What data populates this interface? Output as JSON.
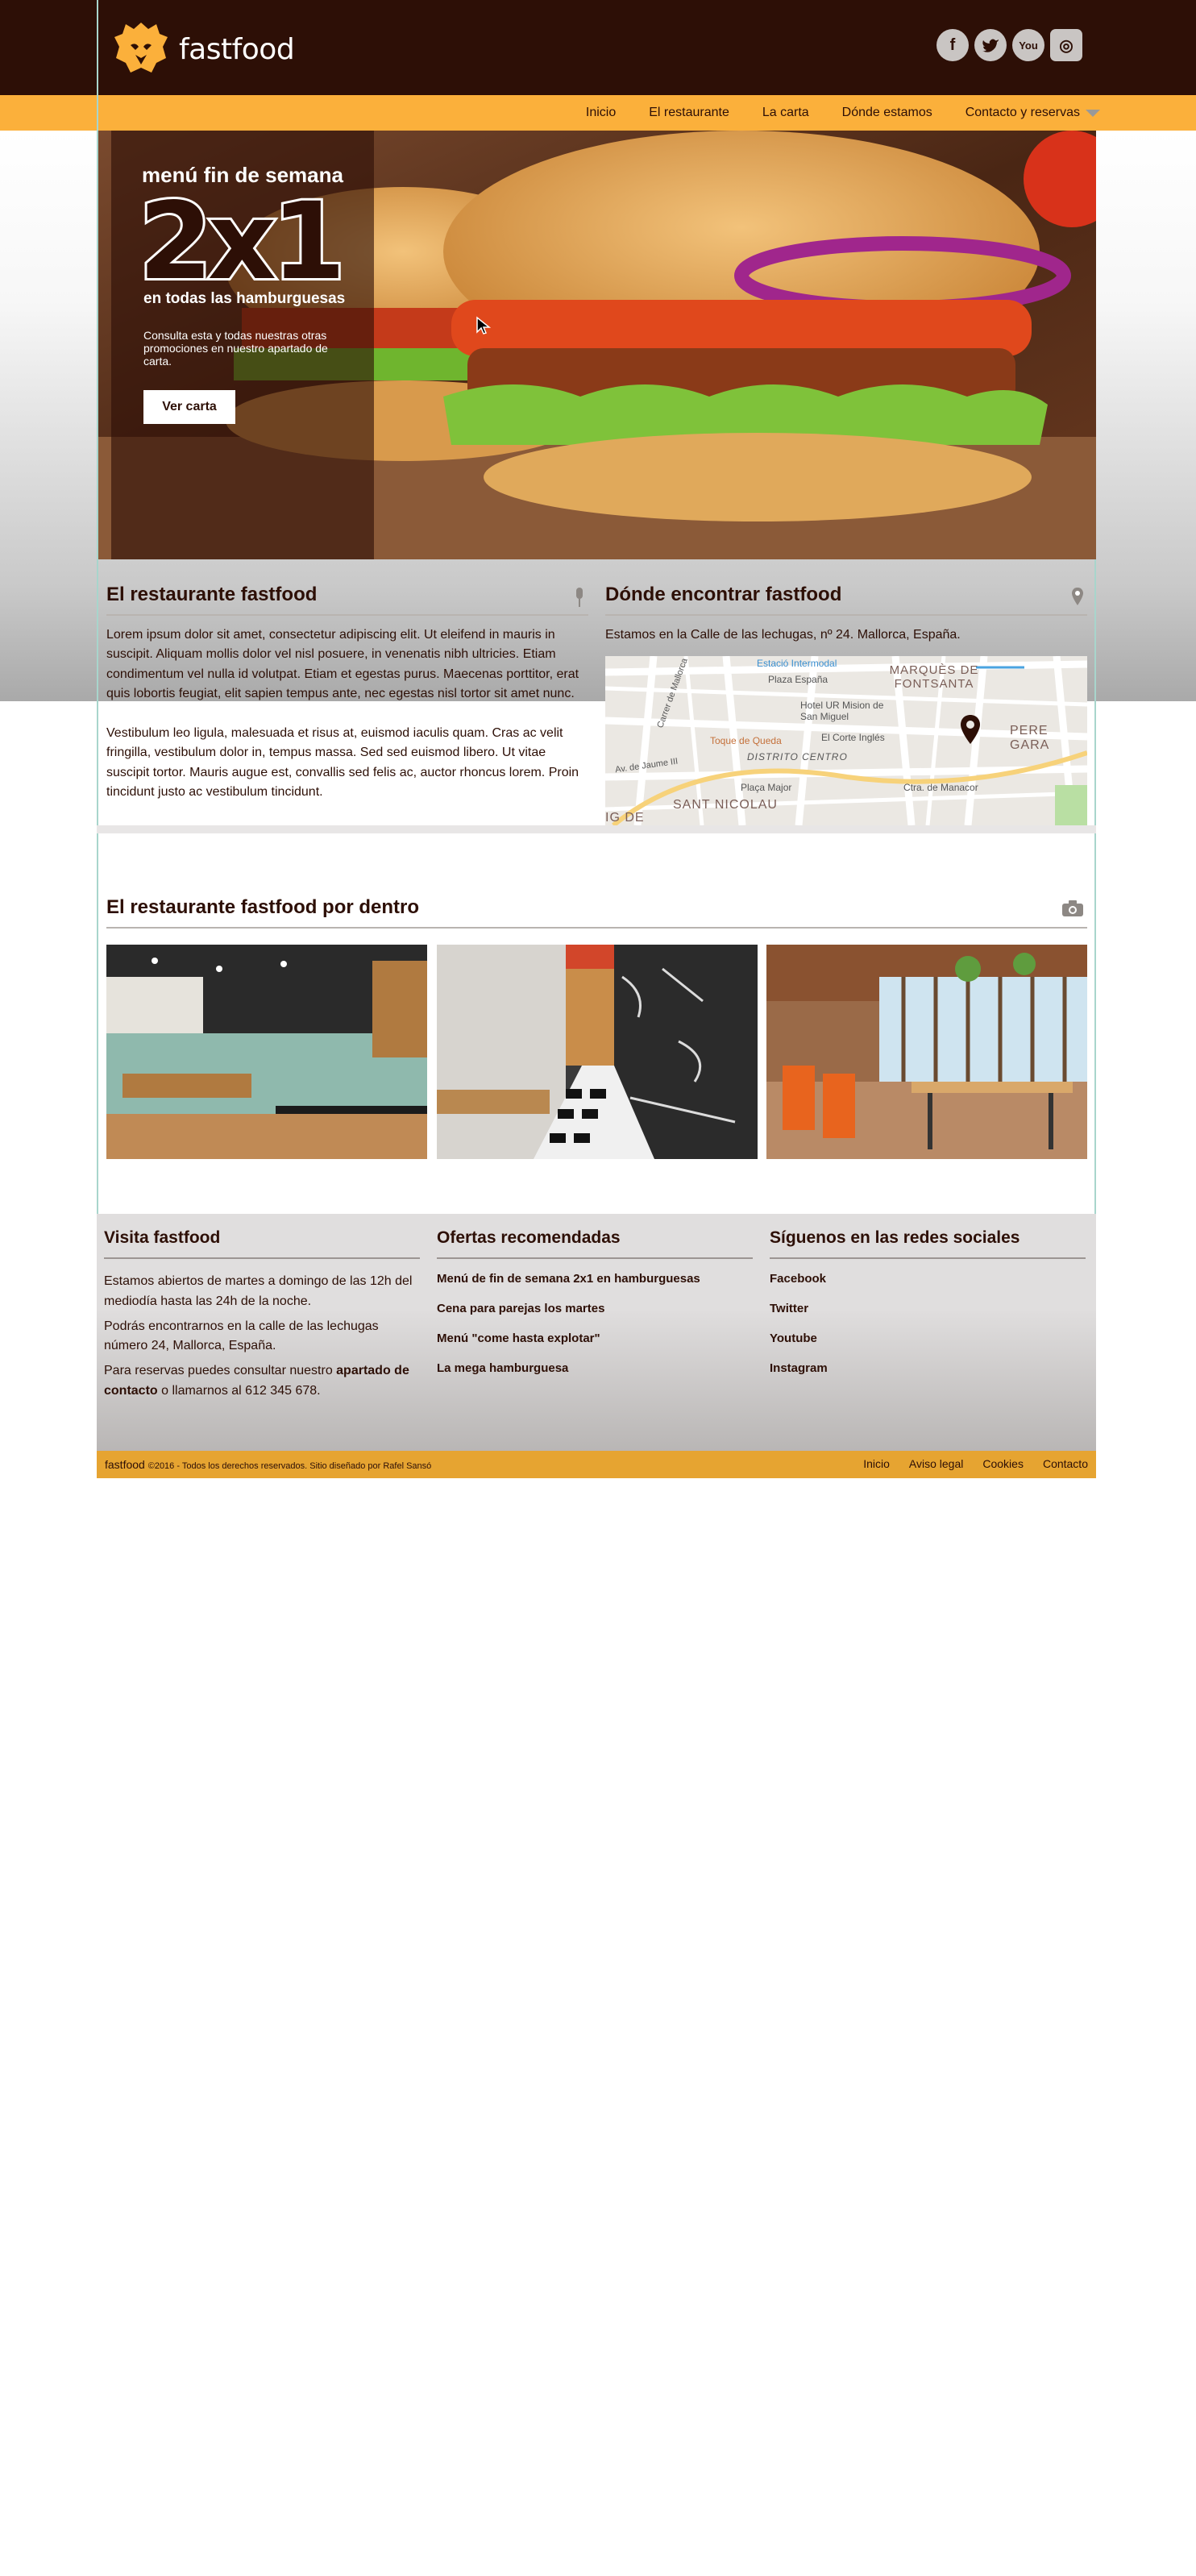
{
  "brand": {
    "name": "fastfood"
  },
  "social": [
    {
      "name": "facebook",
      "glyph": "f"
    },
    {
      "name": "twitter",
      "glyph": "t"
    },
    {
      "name": "youtube",
      "glyph": "You"
    },
    {
      "name": "instagram",
      "glyph": "◎"
    }
  ],
  "nav": [
    "Inicio",
    "El restaurante",
    "La carta",
    "Dónde estamos",
    "Contacto y reservas"
  ],
  "hero": {
    "pre_title": "menú fin de semana",
    "big": "2x1",
    "subtitle": "en todas las hamburguesas",
    "description": "Consulta esta y todas nuestras otras promociones en nuestro apartado de carta.",
    "button": "Ver carta"
  },
  "about": {
    "title_prefix": "El restaurante ",
    "title_brand": "fastfood",
    "p1": "Lorem ipsum dolor sit amet, consectetur adipiscing elit. Ut eleifend in mauris in suscipit. Aliquam mollis dolor vel nisl posuere, in venenatis nibh ultricies. Etiam condimentum vel nulla id volutpat. Etiam et egestas purus. Maecenas porttitor, erat quis lobortis feugiat, elit sapien tempus ante, nec egestas nisl tortor sit amet nunc.",
    "p2": "Vestibulum leo ligula, malesuada et risus at, euismod iaculis quam. Cras ac velit fringilla, vestibulum dolor in, tempus massa. Sed sed euismod libero. Ut vitae suscipit tortor. Mauris augue est, convallis sed felis ac, auctor rhoncus lorem. Proin tincidunt justo ac vestibulum tincidunt."
  },
  "where": {
    "title_prefix": "Dónde encontrar ",
    "title_brand": "fastfood",
    "address": "Estamos en la Calle de las lechugas, nº 24. Mallorca, España.",
    "map_labels": {
      "estacio": "Estació Intermodal",
      "plaza": "Plaza España",
      "hotel": "Hotel UR Mision de San Miguel",
      "corte": "El Corte Inglés",
      "toque": "Toque de Queda",
      "distrito": "DISTRITO CENTRO",
      "placa": "Plaça Major",
      "nicolau": "SANT NICOLAU",
      "marques": "MARQUÈS DE FONTSANTA",
      "pere": "PERE GARA",
      "manacor": "Ctra. de Manacor",
      "jaume": "Av. de Jaume III",
      "mallorca": "Carrer de Mallorca",
      "ig": "IG DE"
    }
  },
  "inside": {
    "title_prefix": "El restaurante ",
    "title_brand": "fastfood",
    "title_suffix": " por dentro"
  },
  "footer": {
    "visit": {
      "title_prefix": "Visita ",
      "title_brand": "fastfood",
      "p1": "Estamos abiertos de martes a domingo de las 12h del mediodía hasta las 24h de la noche.",
      "p2": "Podrás encontrarnos en la calle de las lechugas número 24, Mallorca, España.",
      "p3_prefix": "Para reservas puedes consultar nuestro ",
      "p3_link": "apartado de contacto",
      "p3_suffix": " o llamarnos al 612 345 678."
    },
    "offers": {
      "title": "Ofertas recomendadas",
      "items": [
        "Menú de fin de semana 2x1 en hamburguesas",
        "Cena para parejas los martes",
        "Menú \"come hasta explotar\"",
        "La mega hamburguesa"
      ]
    },
    "follow": {
      "title": "Síguenos en las redes sociales",
      "items": [
        "Facebook",
        "Twitter",
        "Youtube",
        "Instagram"
      ]
    }
  },
  "bottom": {
    "brand": "fastfood",
    "copyright": "©2016 - Todos los derechos reservados. Sitio diseñado por Rafel Sansó",
    "links": [
      "Inicio",
      "Aviso legal",
      "Cookies",
      "Contacto"
    ]
  },
  "colors": {
    "brown": "#2d0f06",
    "orange": "#fbb03b",
    "dark_orange": "#e6a431"
  }
}
